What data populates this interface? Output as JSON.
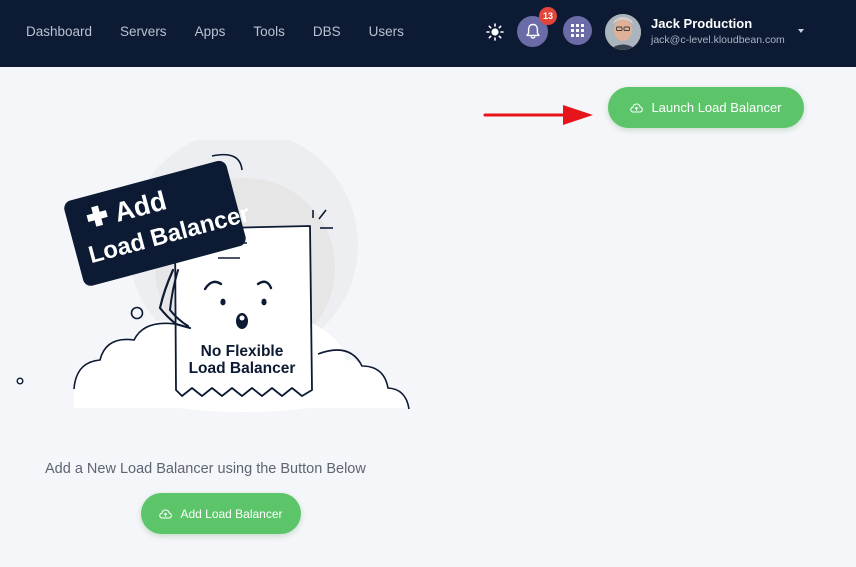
{
  "nav": {
    "items": [
      {
        "label": "Dashboard"
      },
      {
        "label": "Servers"
      },
      {
        "label": "Apps"
      },
      {
        "label": "Tools"
      },
      {
        "label": "DBS"
      },
      {
        "label": "Users"
      }
    ]
  },
  "header": {
    "notification_count": "13",
    "user_name": "Jack Production",
    "user_email": "jack@c-level.kloudbean.com"
  },
  "actions": {
    "launch_label": "Launch Load Balancer"
  },
  "empty_state": {
    "sign_line1": "Add",
    "sign_line2": "Load Balancer",
    "paper_line1": "No Flexible",
    "paper_line2": "Load Balancer",
    "message": "Add a New Load Balancer using the Button Below",
    "add_label": "Add Load Balancer"
  },
  "colors": {
    "topbar": "#0d1a33",
    "accent_green": "#5cc56a",
    "badge_red": "#e4453b",
    "icon_btn": "#6b6ba8",
    "arrow_red": "#e8141b"
  }
}
